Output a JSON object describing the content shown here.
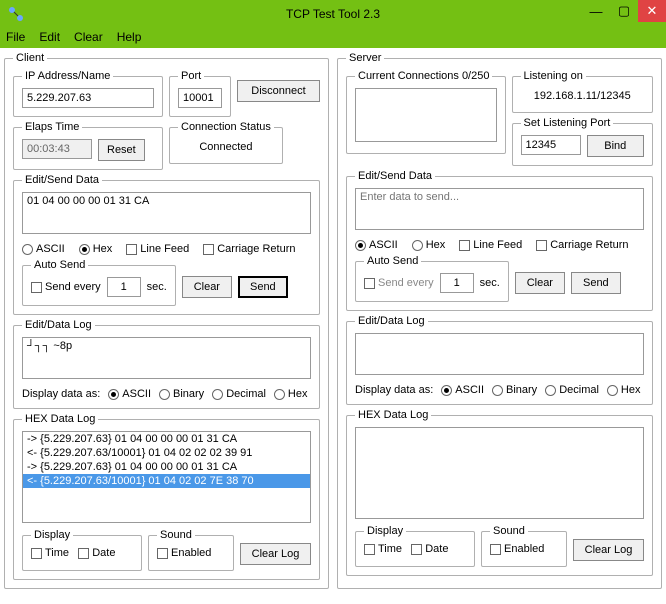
{
  "window": {
    "title": "TCP Test Tool 2.3",
    "minimize": "—",
    "maximize": "▢",
    "close": "✕"
  },
  "menu": {
    "file": "File",
    "edit": "Edit",
    "clear": "Clear",
    "help": "Help"
  },
  "labels": {
    "client": "Client",
    "server": "Server",
    "ip": "IP Address/Name",
    "port": "Port",
    "disconnect": "Disconnect",
    "elaps": "Elaps Time",
    "reset": "Reset",
    "conn_status": "Connection Status",
    "edit_send": "Edit/Send Data",
    "ascii": "ASCII",
    "hex": "Hex",
    "linefeed": "Line Feed",
    "carriage": "Carriage Return",
    "autosend": "Auto Send",
    "sendevery": "Send every",
    "sec": "sec.",
    "clear": "Clear",
    "send": "Send",
    "edit_data_log": "Edit/Data Log",
    "display_as": "Display data as:",
    "binary": "Binary",
    "decimal": "Decimal",
    "hex_data_log": "HEX Data Log",
    "display": "Display",
    "time": "Time",
    "date": "Date",
    "sound": "Sound",
    "enabled": "Enabled",
    "clearlog": "Clear Log",
    "cur_conn": "Current Connections 0/250",
    "listening_on": "Listening on",
    "set_port": "Set Listening Port",
    "bind": "Bind"
  },
  "client": {
    "ip": "5.229.207.63",
    "port": "10001",
    "elaps": "00:03:43",
    "conn_status": "Connected",
    "send_data": "01 04 00 00 00 01 31 CA",
    "send_interval": "1",
    "data_log": "┘┐┐ ~8p",
    "hex_log": [
      {
        "text": "-> {5.229.207.63} 01 04 00 00 00 01 31 CA",
        "selected": false
      },
      {
        "text": "<- {5.229.207.63/10001} 01 04 02 02 02 39 91",
        "selected": false
      },
      {
        "text": "-> {5.229.207.63} 01 04 00 00 00 01 31 CA",
        "selected": false
      },
      {
        "text": "<- {5.229.207.63/10001} 01 04 02 02 7E 38 70",
        "selected": true
      }
    ]
  },
  "server": {
    "listening_on_value": "192.168.1.11/12345",
    "set_port": "12345",
    "send_placeholder": "Enter data to send...",
    "send_interval": "1"
  }
}
